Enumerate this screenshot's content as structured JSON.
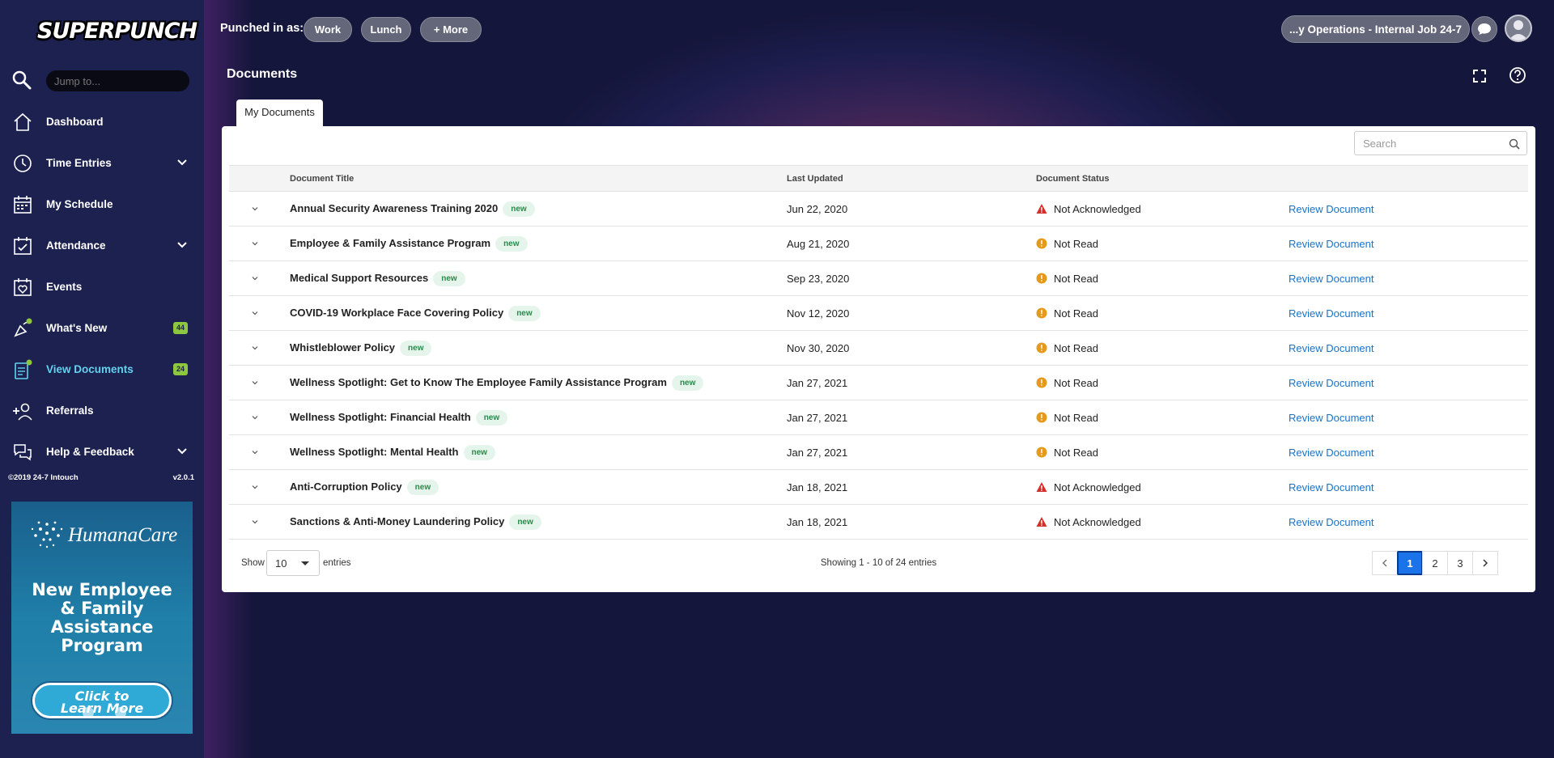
{
  "sidebar": {
    "logo": "SUPERPUNCH",
    "jump_placeholder": "Jump to...",
    "items": [
      {
        "label": "Dashboard",
        "icon": "home-icon"
      },
      {
        "label": "Time Entries",
        "icon": "clock-icon"
      },
      {
        "label": "My Schedule",
        "icon": "calendar-icon"
      },
      {
        "label": "Attendance",
        "icon": "calendar-check-icon"
      },
      {
        "label": "Events",
        "icon": "calendar-heart-icon"
      },
      {
        "label": "What's New",
        "icon": "megaphone-icon",
        "badge": "44"
      },
      {
        "label": "View Documents",
        "icon": "documents-icon",
        "badge": "24"
      },
      {
        "label": "Referrals",
        "icon": "user-plus-icon"
      },
      {
        "label": "Help & Feedback",
        "icon": "help-feedback-icon"
      }
    ],
    "copyright": "©2019 24-7 Intouch",
    "version": "v2.0.1",
    "promo": {
      "brand": "HumanaCare",
      "headline_lines": [
        "New Employee",
        "& Family",
        "Assistance",
        "Program"
      ],
      "cta_lines": [
        "Click to",
        "Learn More"
      ]
    }
  },
  "topbar": {
    "punched_label": "Punched in as:",
    "pills": [
      "Work",
      "Lunch",
      "+ More"
    ],
    "job": "...y Operations - Internal Job 24-7"
  },
  "page": {
    "title": "Documents",
    "tab": "My Documents",
    "search_placeholder": "Search"
  },
  "table": {
    "headers": [
      "Document Title",
      "Last Updated",
      "Document Status"
    ],
    "new_label": "new",
    "action_label": "Review Document",
    "rows": [
      {
        "title": "Annual Security Awareness Training 2020",
        "updated": "Jun 22, 2020",
        "status": "Not Acknowledged",
        "kind": "warning"
      },
      {
        "title": "Employee & Family Assistance Program",
        "updated": "Aug 21, 2020",
        "status": "Not Read",
        "kind": "info"
      },
      {
        "title": "Medical Support Resources",
        "updated": "Sep 23, 2020",
        "status": "Not Read",
        "kind": "info"
      },
      {
        "title": "COVID-19 Workplace Face Covering Policy",
        "updated": "Nov 12, 2020",
        "status": "Not Read",
        "kind": "info"
      },
      {
        "title": "Whistleblower Policy",
        "updated": "Nov 30, 2020",
        "status": "Not Read",
        "kind": "info"
      },
      {
        "title": "Wellness Spotlight: Get to Know The Employee Family Assistance Program",
        "updated": "Jan 27, 2021",
        "status": "Not Read",
        "kind": "info"
      },
      {
        "title": "Wellness Spotlight: Financial Health",
        "updated": "Jan 27, 2021",
        "status": "Not Read",
        "kind": "info"
      },
      {
        "title": "Wellness Spotlight: Mental Health",
        "updated": "Jan 27, 2021",
        "status": "Not Read",
        "kind": "info"
      },
      {
        "title": "Anti-Corruption Policy",
        "updated": "Jan 18, 2021",
        "status": "Not Acknowledged",
        "kind": "warning"
      },
      {
        "title": "Sanctions & Anti-Money Laundering Policy",
        "updated": "Jan 18, 2021",
        "status": "Not Acknowledged",
        "kind": "warning"
      }
    ]
  },
  "footer": {
    "show_label": "Show",
    "page_size": "10",
    "entries_label": "entries",
    "showing": "Showing 1 - 10 of 24 entries",
    "pages": [
      "1",
      "2",
      "3"
    ],
    "current_page": "1"
  },
  "colors": {
    "sidebar_bg": "#1d2150",
    "accent_active": "#62d2f0",
    "badge_green": "#8dc63f",
    "link_blue": "#1a73c9",
    "warning_red": "#d0312d",
    "info_orange": "#e59a1c",
    "page_active": "#1a73e8"
  }
}
